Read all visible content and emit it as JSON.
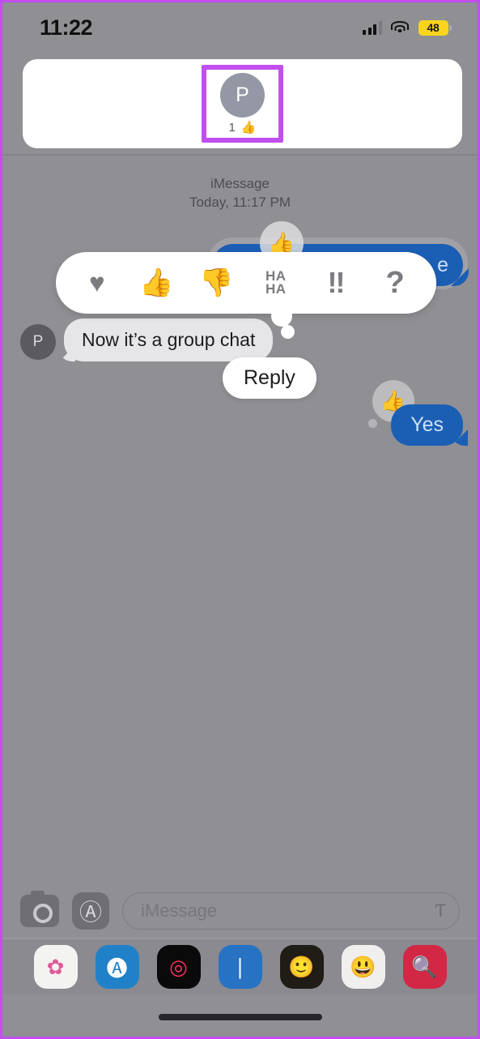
{
  "statusbar": {
    "time": "11:22",
    "cellular_icon": "signal-bars-icon",
    "wifi_icon": "wifi-icon",
    "battery_level": "48",
    "battery_icon": "battery-low-power-icon"
  },
  "header_card": {
    "reactor_initial": "P",
    "reaction_count": "1",
    "reaction_emoji": "👍",
    "avatar_icon": "contact-avatar-icon",
    "highlight_color": "#c14ff0"
  },
  "conversation": {
    "service_label": "iMessage",
    "timestamp": "Today, 11:17 PM",
    "messages": [
      {
        "id": "sent-top",
        "text": "Are you there",
        "side": "sent",
        "tapback": "👍",
        "selected": true
      },
      {
        "id": "received-group",
        "text": "Now it’s a group chat",
        "side": "received",
        "avatar_initial": "P"
      },
      {
        "id": "sent-yes",
        "text": "Yes",
        "side": "sent",
        "tapback": "👍"
      }
    ],
    "reply_action": "Reply"
  },
  "tapback_bar": {
    "options": [
      {
        "name": "heart",
        "glyph": "♥"
      },
      {
        "name": "thumbs-up",
        "glyph": "👍"
      },
      {
        "name": "thumbs-down",
        "glyph": "👎"
      },
      {
        "name": "haha",
        "line1": "HA",
        "line2": "HA"
      },
      {
        "name": "exclamation",
        "glyph": "!!"
      },
      {
        "name": "question",
        "glyph": "?"
      }
    ]
  },
  "input_bar": {
    "camera_icon": "camera-icon",
    "appstore_icon": "app-store-icon",
    "placeholder": "iMessage",
    "mic_icon": "microphone-icon"
  },
  "app_drawer": {
    "apps": [
      {
        "name": "photos-app-icon",
        "glyph": "✿",
        "bg": "#f3f3f1",
        "fg": "#e05a9a"
      },
      {
        "name": "app-store-app-icon",
        "glyph": "🅐",
        "bg": "#2081c8",
        "fg": "#ffffff"
      },
      {
        "name": "fitness-app-icon",
        "glyph": "◎",
        "bg": "#0a0a0a",
        "fg": "#f5325b"
      },
      {
        "name": "music-waveform-app-icon",
        "glyph": "∣",
        "bg": "#2872c4",
        "fg": "#ffffff"
      },
      {
        "name": "memoji-app-icon",
        "glyph": "🙂",
        "bg": "#201c16",
        "fg": "#e8d46a"
      },
      {
        "name": "memoji-stickers-app-icon",
        "glyph": "😃",
        "bg": "#f0efed",
        "fg": "#d1452e"
      },
      {
        "name": "images-search-app-icon",
        "glyph": "🔍",
        "bg": "#d22846",
        "fg": "#ffffff"
      }
    ]
  }
}
